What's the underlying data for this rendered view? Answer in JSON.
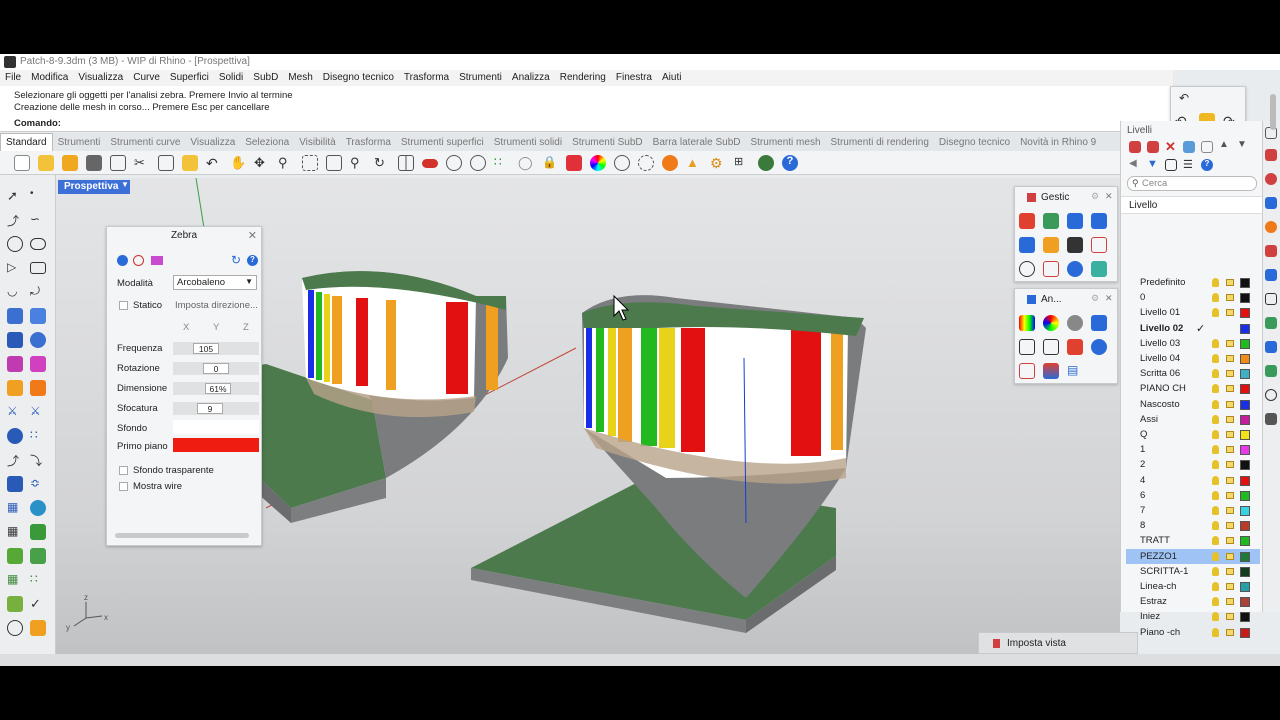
{
  "window": {
    "title": "Patch-8-9.3dm (3 MB) - WIP di Rhino - [Prospettiva]",
    "controls": [
      "minimize-icon",
      "restore-icon",
      "close-icon"
    ]
  },
  "menu": [
    "File",
    "Modifica",
    "Visualizza",
    "Curve",
    "Superfici",
    "Solidi",
    "SubD",
    "Mesh",
    "Disegno tecnico",
    "Trasforma",
    "Strumenti",
    "Analizza",
    "Rendering",
    "Finestra",
    "Aiuti"
  ],
  "command_history": [
    "Selezionare gli oggetti per l'analisi zebra. Premere Invio al termine",
    "Creazione delle mesh in corso... Premere Esc per cancellare"
  ],
  "command_prompt": "Comando:",
  "toolbar_tabs": [
    "Standard",
    "Strumenti",
    "Strumenti curve",
    "Visualizza",
    "Seleziona",
    "Visibilità",
    "Trasforma",
    "Strumenti superfici",
    "Strumenti solidi",
    "Strumenti SubD",
    "Barra laterale SubD",
    "Strumenti mesh",
    "Strumenti di rendering",
    "Disegno tecnico",
    "Novità in Rhino 9"
  ],
  "active_tab": "Standard",
  "viewport": {
    "label": "Prospettiva",
    "axes": {
      "x": "x",
      "y": "y",
      "z": "z"
    }
  },
  "zebra_panel": {
    "title": "Zebra",
    "mode_label": "Modalità",
    "mode_value": "Arcobaleno",
    "static_label": "Statico",
    "direction_label": "Imposta direzione...",
    "axis_labels": [
      "X",
      "Y",
      "Z"
    ],
    "frequency_label": "Frequenza",
    "frequency_value": "105",
    "rotation_label": "Rotazione",
    "rotation_value": "0",
    "size_label": "Dimensione",
    "size_value": "61%",
    "blur_label": "Sfocatura",
    "blur_value": "9",
    "background_label": "Sfondo",
    "background_color": "#ffffff",
    "foreground_label": "Primo piano",
    "foreground_color": "#ef1c12",
    "transparent_bg_label": "Sfondo trasparente",
    "show_wire_label": "Mostra wire"
  },
  "gestione_panel": {
    "title": "Gestic"
  },
  "analisi_panel": {
    "title": "An..."
  },
  "layers_panel": {
    "title": "Livelli",
    "search_placeholder": "Cerca",
    "column_header": "Livello",
    "layers": [
      {
        "name": "Predefinito",
        "color": "#111111",
        "current": false,
        "selected": false
      },
      {
        "name": "0",
        "color": "#111111",
        "current": false,
        "selected": false
      },
      {
        "name": "Livello 01",
        "color": "#e21010",
        "current": false,
        "selected": false
      },
      {
        "name": "Livello 02",
        "color": "#1a2ee8",
        "current": true,
        "selected": false
      },
      {
        "name": "Livello 03",
        "color": "#22b81f",
        "current": false,
        "selected": false
      },
      {
        "name": "Livello 04",
        "color": "#f08a18",
        "current": false,
        "selected": false
      },
      {
        "name": "Scritta 06",
        "color": "#3fb0c4",
        "current": false,
        "selected": false
      },
      {
        "name": "PIANO CH",
        "color": "#e21010",
        "current": false,
        "selected": false
      },
      {
        "name": "Nascosto",
        "color": "#1a2ee8",
        "current": false,
        "selected": false
      },
      {
        "name": "Assi",
        "color": "#c61c9e",
        "current": false,
        "selected": false
      },
      {
        "name": "Q",
        "color": "#f2e21a",
        "current": false,
        "selected": false
      },
      {
        "name": "1",
        "color": "#e838e8",
        "current": false,
        "selected": false
      },
      {
        "name": "2",
        "color": "#111111",
        "current": false,
        "selected": false
      },
      {
        "name": "4",
        "color": "#e21010",
        "current": false,
        "selected": false
      },
      {
        "name": "6",
        "color": "#22b81f",
        "current": false,
        "selected": false
      },
      {
        "name": "7",
        "color": "#39d2e0",
        "current": false,
        "selected": false
      },
      {
        "name": "8",
        "color": "#b83a2a",
        "current": false,
        "selected": false
      },
      {
        "name": "TRATT",
        "color": "#22b81f",
        "current": false,
        "selected": false
      },
      {
        "name": "PEZZO1",
        "color": "#1f7a3a",
        "current": false,
        "selected": true
      },
      {
        "name": "SCRITTA-1",
        "color": "#133d1e",
        "current": false,
        "selected": false
      },
      {
        "name": "Linea-ch",
        "color": "#2a9ea8",
        "current": false,
        "selected": false
      },
      {
        "name": "Estraz",
        "color": "#a8423a",
        "current": false,
        "selected": false
      },
      {
        "name": "Iniez",
        "color": "#111111",
        "current": false,
        "selected": false
      },
      {
        "name": "Piano -ch",
        "color": "#c81a1a",
        "current": false,
        "selected": false
      }
    ]
  },
  "imposta_vista": {
    "label": "Imposta vista"
  },
  "colors": {
    "accent": "#3d6fd8",
    "selection": "#9fc3f5",
    "model_top": "#4c7a4c",
    "model_side": "#8a8c8e"
  }
}
